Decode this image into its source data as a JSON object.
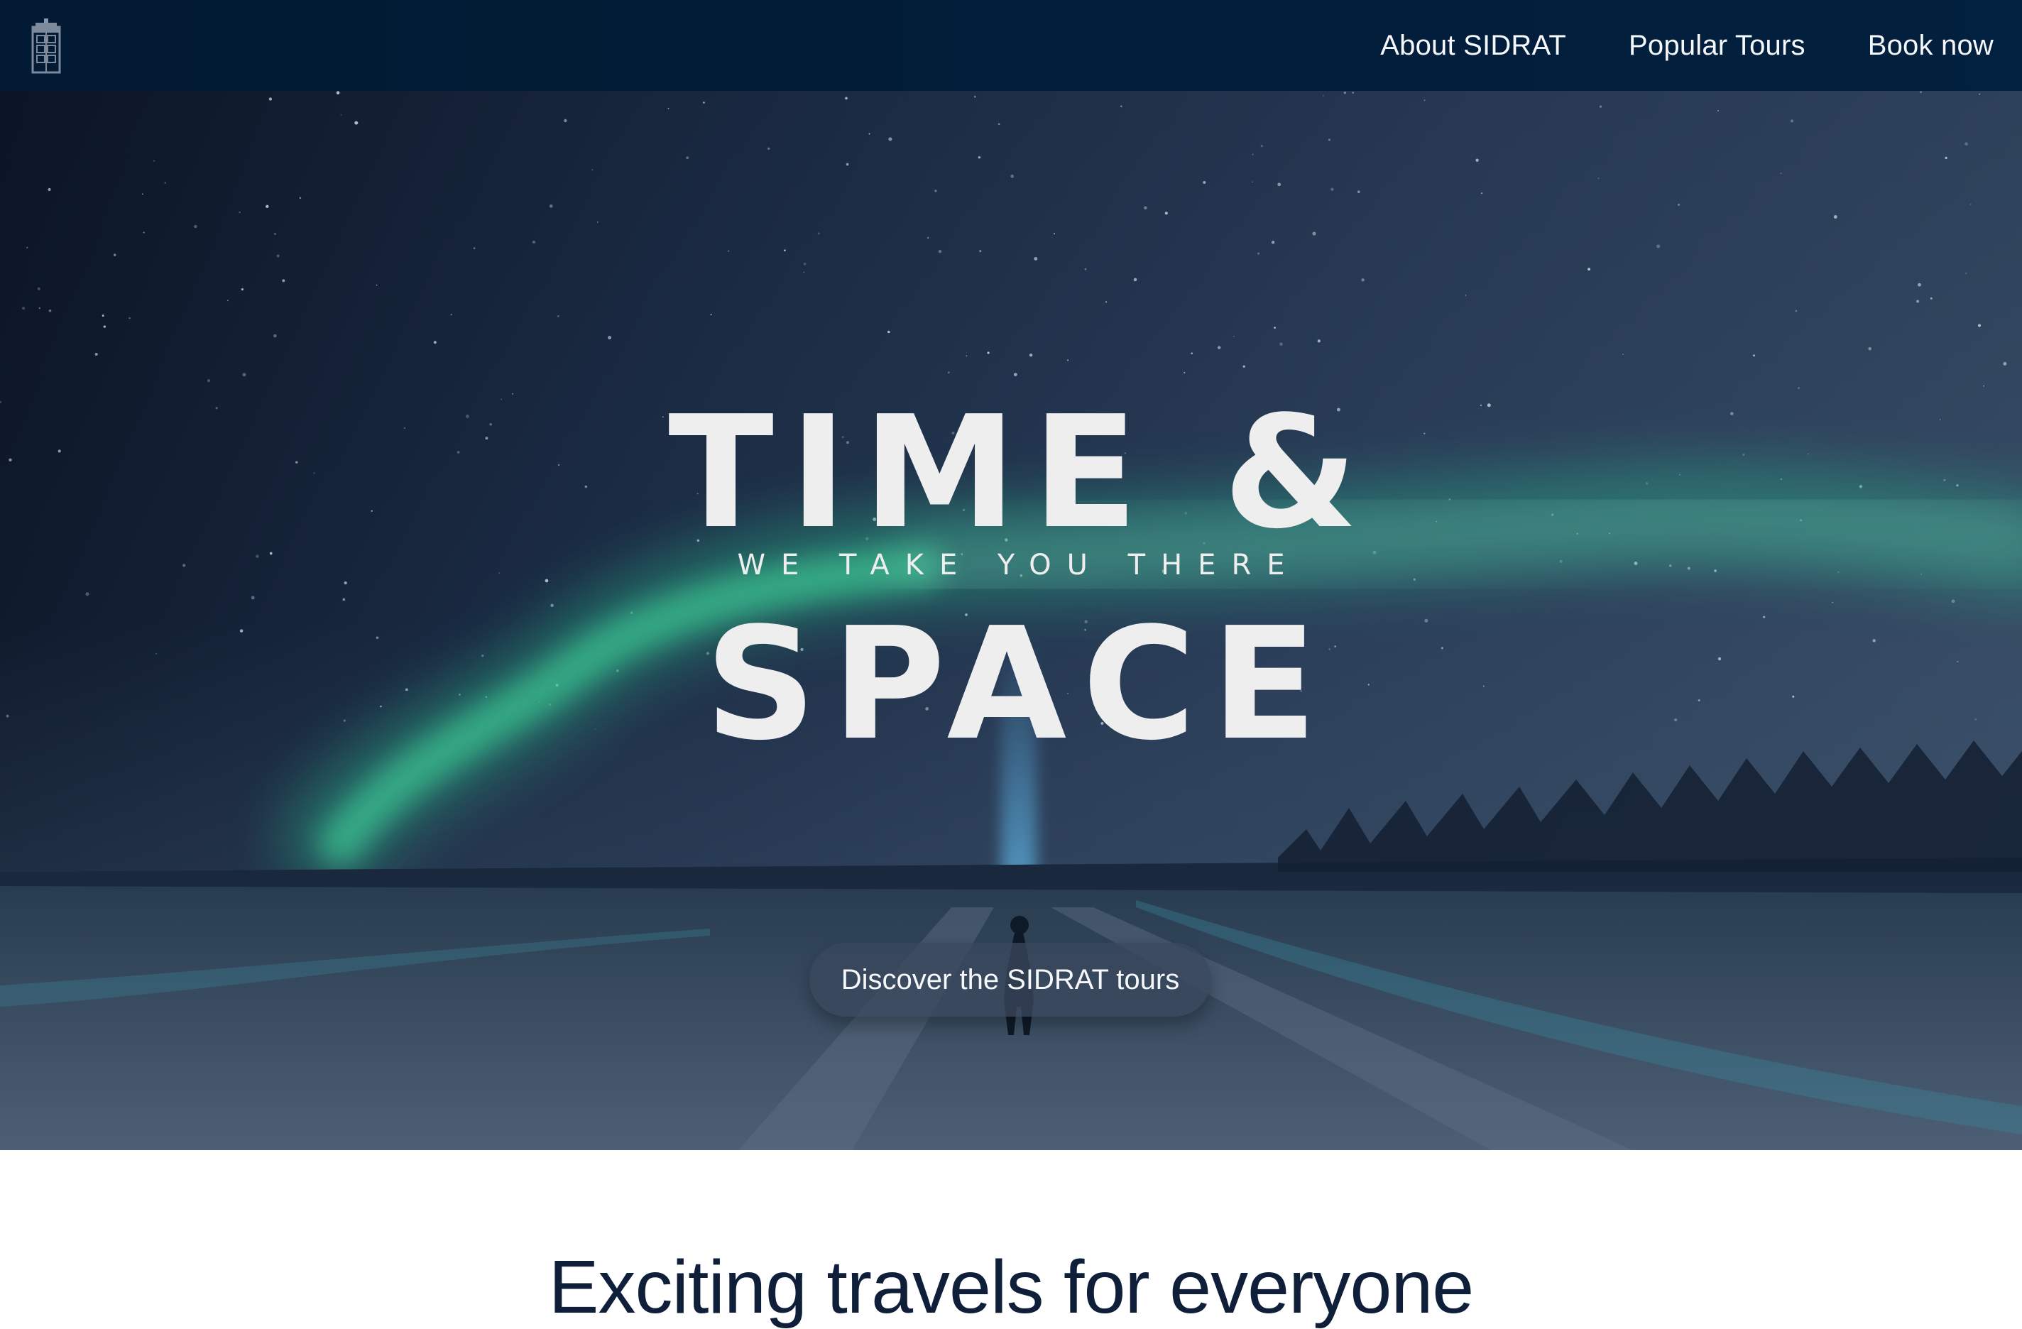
{
  "nav": {
    "logo_icon": "police-box-icon",
    "links": [
      {
        "label": "About SIDRAT"
      },
      {
        "label": "Popular Tours"
      },
      {
        "label": "Book now"
      }
    ]
  },
  "hero": {
    "title_top": "TIME &",
    "subtitle": "WE TAKE YOU THERE",
    "title_bottom": "SPACE",
    "cta_label": "Discover the SIDRAT tours"
  },
  "section": {
    "heading": "Exciting travels for everyone"
  },
  "colors": {
    "navbar": "#021a33",
    "hero_text": "#eeeeef",
    "heading_text": "#0f1f3a",
    "aurora": "#3fbf8f"
  }
}
